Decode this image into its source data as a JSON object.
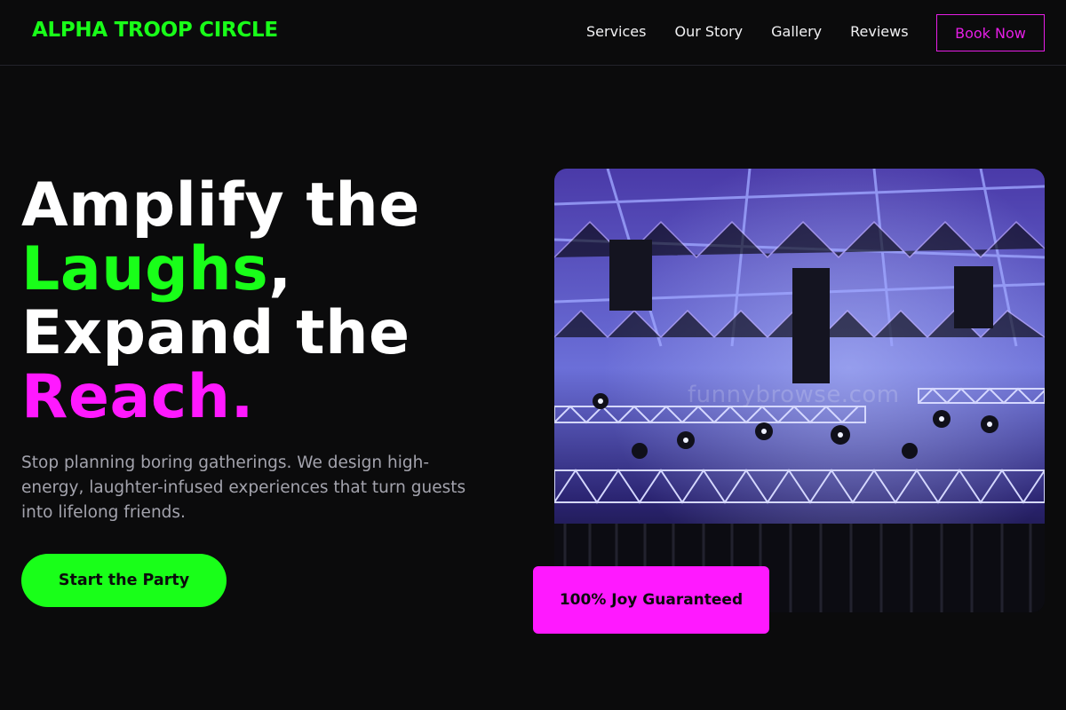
{
  "nav": {
    "brand": "ALPHA TROOP CIRCLE",
    "links": [
      "Services",
      "Our Story",
      "Gallery",
      "Reviews"
    ],
    "cta_label": "Book Now"
  },
  "hero": {
    "headline_line1": "Amplify the",
    "headline_highlight1": "Laughs",
    "headline_comma": ",",
    "headline_line3": "Expand the",
    "headline_highlight2": "Reach.",
    "subtext": "Stop planning boring gatherings. We design high-energy, laughter-infused experiences that turn guests into lifelong friends.",
    "cta_label": "Start the Party",
    "badge": "100% Joy Guaranteed",
    "image_watermark": "funnybrowse.com"
  },
  "colors": {
    "background": "#0b0b0c",
    "accent_green": "#19ff19",
    "accent_magenta": "#ff19ff",
    "muted_text": "#a3a3ad"
  }
}
